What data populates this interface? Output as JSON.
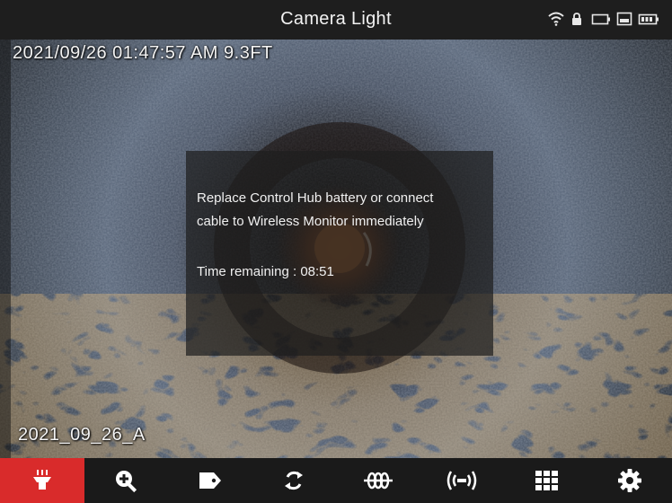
{
  "header": {
    "title": "Camera Light",
    "status_icons": [
      "wifi-icon",
      "lock-icon",
      "battery-icon",
      "sd-card-icon",
      "monitor-battery-icon"
    ]
  },
  "feed": {
    "timestamp": "2021/09/26 01:47:57 AM 9.3FT",
    "filename": "2021_09_26_A"
  },
  "dialog": {
    "message_line1": "Replace Control Hub battery or connect",
    "message_line2": "cable to Wireless Monitor immediately",
    "time_remaining": "Time remaining : 08:51"
  },
  "toolbar": {
    "buttons": [
      {
        "icon": "camera-light-icon",
        "active": true
      },
      {
        "icon": "zoom-in-icon",
        "active": false
      },
      {
        "icon": "tag-icon",
        "active": false
      },
      {
        "icon": "rotate-icon",
        "active": false
      },
      {
        "icon": "spring-icon",
        "active": false
      },
      {
        "icon": "wireless-icon",
        "active": false
      },
      {
        "icon": "grid-icon",
        "active": false
      },
      {
        "icon": "settings-icon",
        "active": false
      }
    ]
  },
  "colors": {
    "active_button": "#d92b2b",
    "bar_background": "#1a1a1a"
  }
}
